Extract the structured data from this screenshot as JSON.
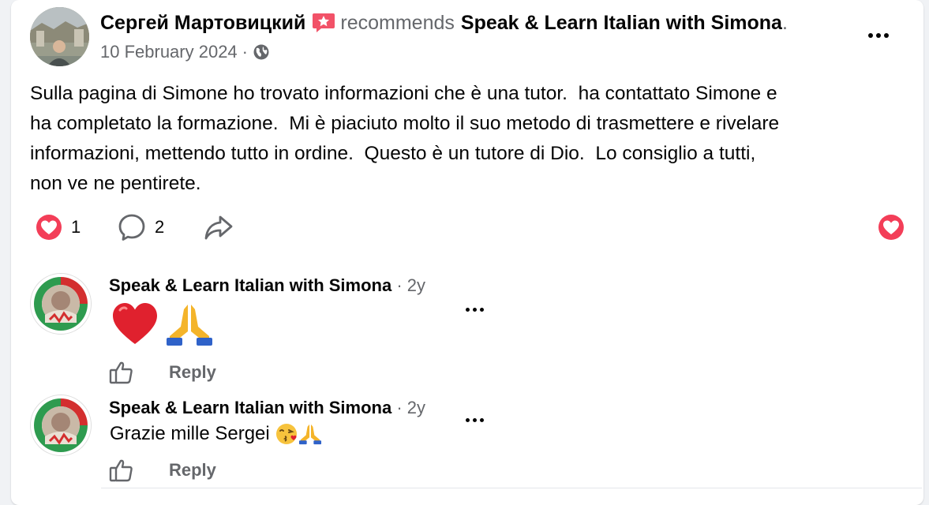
{
  "post": {
    "author": "Сергей Мартовицкий",
    "action": "recommends",
    "page": "Speak & Learn Italian with Simona",
    "trailing_dot": ".",
    "date": "10 February 2024",
    "separator": "·",
    "audience_icon": "globe-icon",
    "body": "Sulla pagina di Simone ho trovato informazioni che è una tutor.  ha contattato Simone e\nha completato la formazione.  Mi è piaciuto molto il suo metodo di trasmettere e rivelare\ninformazioni, mettendo tutto in ordine.  Questo è un tutore di Dio.  Lo consiglio a tutti,\nnon ve ne pentirete.",
    "reactions_count": "1",
    "comments_count": "2"
  },
  "comments": [
    {
      "author": "Speak & Learn Italian with Simona",
      "separator": "·",
      "time": "2y",
      "body": "",
      "emojis": [
        "red-heart",
        "folded-hands"
      ],
      "reply_label": "Reply"
    },
    {
      "author": "Speak & Learn Italian with Simona",
      "separator": "·",
      "time": "2y",
      "body": "Grazie mille Sergei ",
      "emojis": [
        "face-blowing-kiss",
        "folded-hands"
      ],
      "reply_label": "Reply"
    }
  ],
  "colors": {
    "heart_red": "#f33e58",
    "muted_text": "#65676b",
    "recommend_pink": "#f25268"
  }
}
